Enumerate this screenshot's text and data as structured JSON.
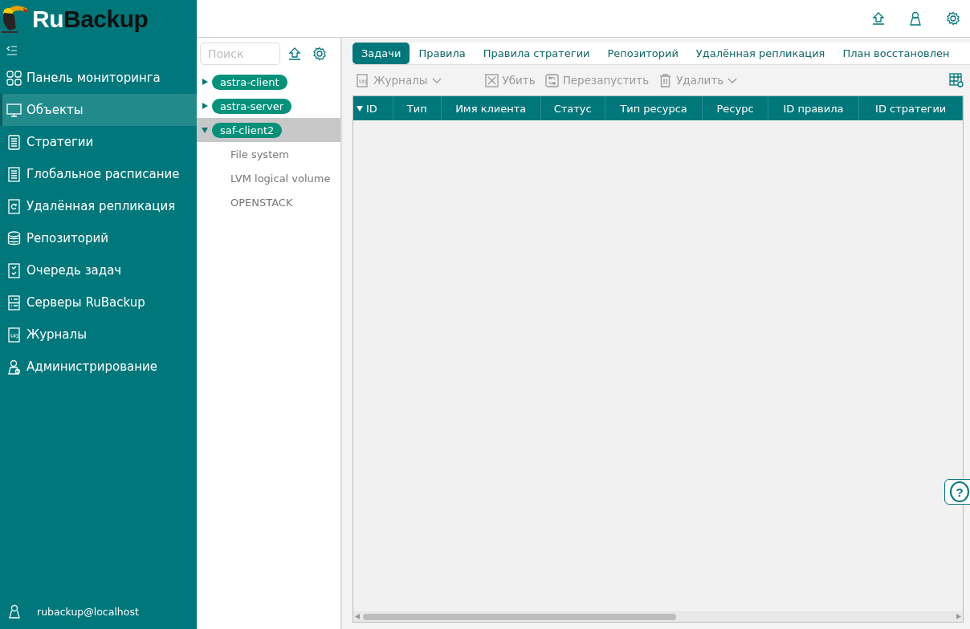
{
  "logo": {
    "first": "Ru",
    "second": "Backup"
  },
  "sidebar": {
    "items": [
      {
        "label": "Панель мониторинга",
        "selected": false
      },
      {
        "label": "Объекты",
        "selected": true
      },
      {
        "label": "Стратегии",
        "selected": false
      },
      {
        "label": "Глобальное расписание",
        "selected": false
      },
      {
        "label": "Удалённая репликация",
        "selected": false
      },
      {
        "label": "Репозиторий",
        "selected": false
      },
      {
        "label": "Очередь задач",
        "selected": false
      },
      {
        "label": "Серверы RuBackup",
        "selected": false
      },
      {
        "label": "Журналы",
        "selected": false
      },
      {
        "label": "Администрирование",
        "selected": false
      }
    ],
    "user": "rubackup@localhost"
  },
  "tree": {
    "search": {
      "placeholder": "Поиск"
    },
    "nodes": [
      {
        "label": "astra-client",
        "expanded": false,
        "selected": false
      },
      {
        "label": "astra-server",
        "expanded": false,
        "selected": false
      },
      {
        "label": "saf-client2",
        "expanded": true,
        "selected": true,
        "children": [
          {
            "label": "File system"
          },
          {
            "label": "LVM logical volume"
          },
          {
            "label": "OPENSTACK"
          }
        ]
      }
    ]
  },
  "tabs": [
    {
      "label": "Задачи",
      "selected": true
    },
    {
      "label": "Правила",
      "selected": false
    },
    {
      "label": "Правила стратегии",
      "selected": false
    },
    {
      "label": "Репозиторий",
      "selected": false
    },
    {
      "label": "Удалённая репликация",
      "selected": false
    },
    {
      "label": "План восстановлен",
      "selected": false
    }
  ],
  "toolbar": [
    {
      "label": "Журналы",
      "disabled": true,
      "has_menu": true
    },
    {
      "label": "Убить",
      "disabled": true,
      "has_menu": false
    },
    {
      "label": "Перезапустить",
      "disabled": true,
      "has_menu": false
    },
    {
      "label": "Удалить",
      "disabled": true,
      "has_menu": true
    }
  ],
  "table": {
    "columns": [
      {
        "label": "ID",
        "sorted": true
      },
      {
        "label": "Тип",
        "sorted": false
      },
      {
        "label": "Имя клиента",
        "sorted": false
      },
      {
        "label": "Статус",
        "sorted": false
      },
      {
        "label": "Тип ресурса",
        "sorted": false
      },
      {
        "label": "Ресурс",
        "sorted": false
      },
      {
        "label": "ID правила",
        "sorted": false
      },
      {
        "label": "ID стратегии",
        "sorted": false
      }
    ]
  },
  "help": "?"
}
